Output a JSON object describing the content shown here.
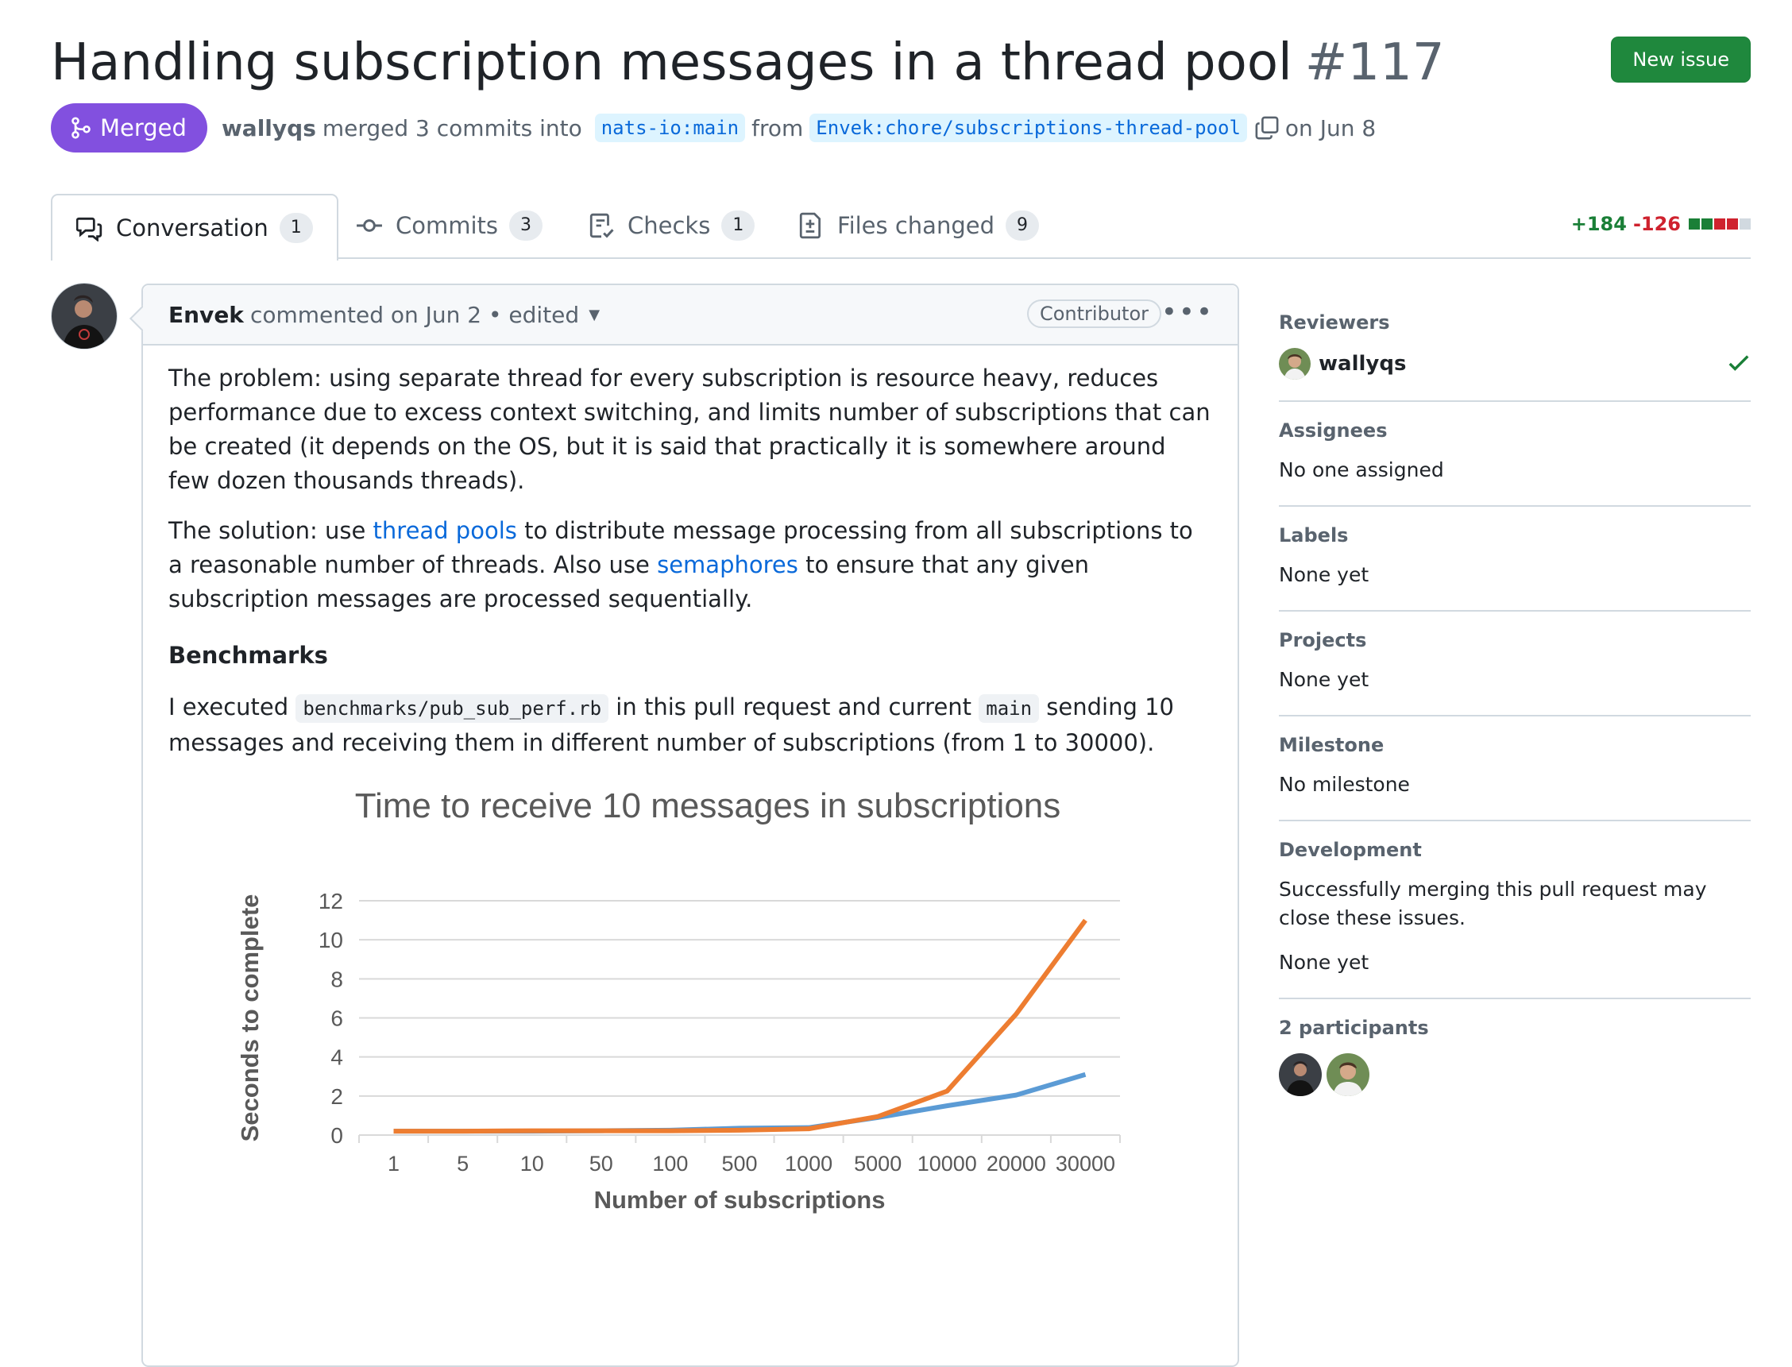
{
  "header": {
    "title": "Handling subscription messages in a thread pool",
    "number": "#117",
    "new_issue_label": "New issue"
  },
  "meta": {
    "state": "Merged",
    "author": "wallyqs",
    "merged_text": "merged 3 commits into",
    "base_branch": "nats-io:main",
    "from_text": "from",
    "head_branch": "Envek:chore/subscriptions-thread-pool",
    "date_text": "on Jun 8"
  },
  "tabs": [
    {
      "label": "Conversation",
      "count": "1",
      "icon": "comment-discussion-icon"
    },
    {
      "label": "Commits",
      "count": "3",
      "icon": "commit-icon"
    },
    {
      "label": "Checks",
      "count": "1",
      "icon": "checklist-icon"
    },
    {
      "label": "Files changed",
      "count": "9",
      "icon": "file-diff-icon"
    }
  ],
  "diffstat": {
    "added": "+184",
    "removed": "-126",
    "colors": [
      "#1a7f37",
      "#1a7f37",
      "#cf222e",
      "#cf222e",
      "#d1d9e0"
    ]
  },
  "comment": {
    "author": "Envek",
    "meta": "commented on Jun 2 • edited",
    "role": "Contributor",
    "p1": "The problem: using separate thread for every subscription is resource heavy, reduces performance due to excess context switching, and limits number of subscriptions that can be created (it depends on the OS, but it is said that practically it is somewhere around few dozen thousands threads).",
    "p2_pre": "The solution: use",
    "p2_link1": "thread pools",
    "p2_mid": "to distribute message processing from all subscriptions to a reasonable number of threads. Also use",
    "p2_link2": "semaphores",
    "p2_post": "to ensure that any given subscription messages are processed sequentially.",
    "heading": "Benchmarks",
    "p3_a": "I executed",
    "p3_code1": "benchmarks/pub_sub_perf.rb",
    "p3_b": "in this pull request and current",
    "p3_code2": "main",
    "p3_c": "sending 10 messages and receiving them in different number of subscriptions (from 1 to 30000)."
  },
  "chart_data": {
    "type": "line",
    "title": "Time to receive 10 messages in subscriptions",
    "xlabel": "Number of subscriptions",
    "ylabel": "Seconds to complete",
    "categories": [
      "1",
      "5",
      "10",
      "50",
      "100",
      "500",
      "1000",
      "5000",
      "10000",
      "20000",
      "30000"
    ],
    "ylim": [
      0,
      12
    ],
    "yticks": [
      0,
      2,
      4,
      6,
      8,
      10,
      12
    ],
    "grid": true,
    "legend": "none",
    "series": [
      {
        "color": "#5b9bd5",
        "values": [
          0.2,
          0.2,
          0.2,
          0.22,
          0.25,
          0.35,
          0.38,
          0.9,
          1.5,
          2.05,
          3.1
        ]
      },
      {
        "color": "#ed7d31",
        "values": [
          0.2,
          0.2,
          0.22,
          0.22,
          0.22,
          0.25,
          0.32,
          0.95,
          2.25,
          6.2,
          11.0
        ]
      }
    ]
  },
  "sidebar": {
    "reviewers_heading": "Reviewers",
    "reviewer_name": "wallyqs",
    "assignees_heading": "Assignees",
    "assignees_value": "No one assigned",
    "labels_heading": "Labels",
    "labels_value": "None yet",
    "projects_heading": "Projects",
    "projects_value": "None yet",
    "milestone_heading": "Milestone",
    "milestone_value": "No milestone",
    "development_heading": "Development",
    "development_text": "Successfully merging this pull request may close these issues.",
    "development_value": "None yet",
    "participants_heading": "2 participants"
  }
}
